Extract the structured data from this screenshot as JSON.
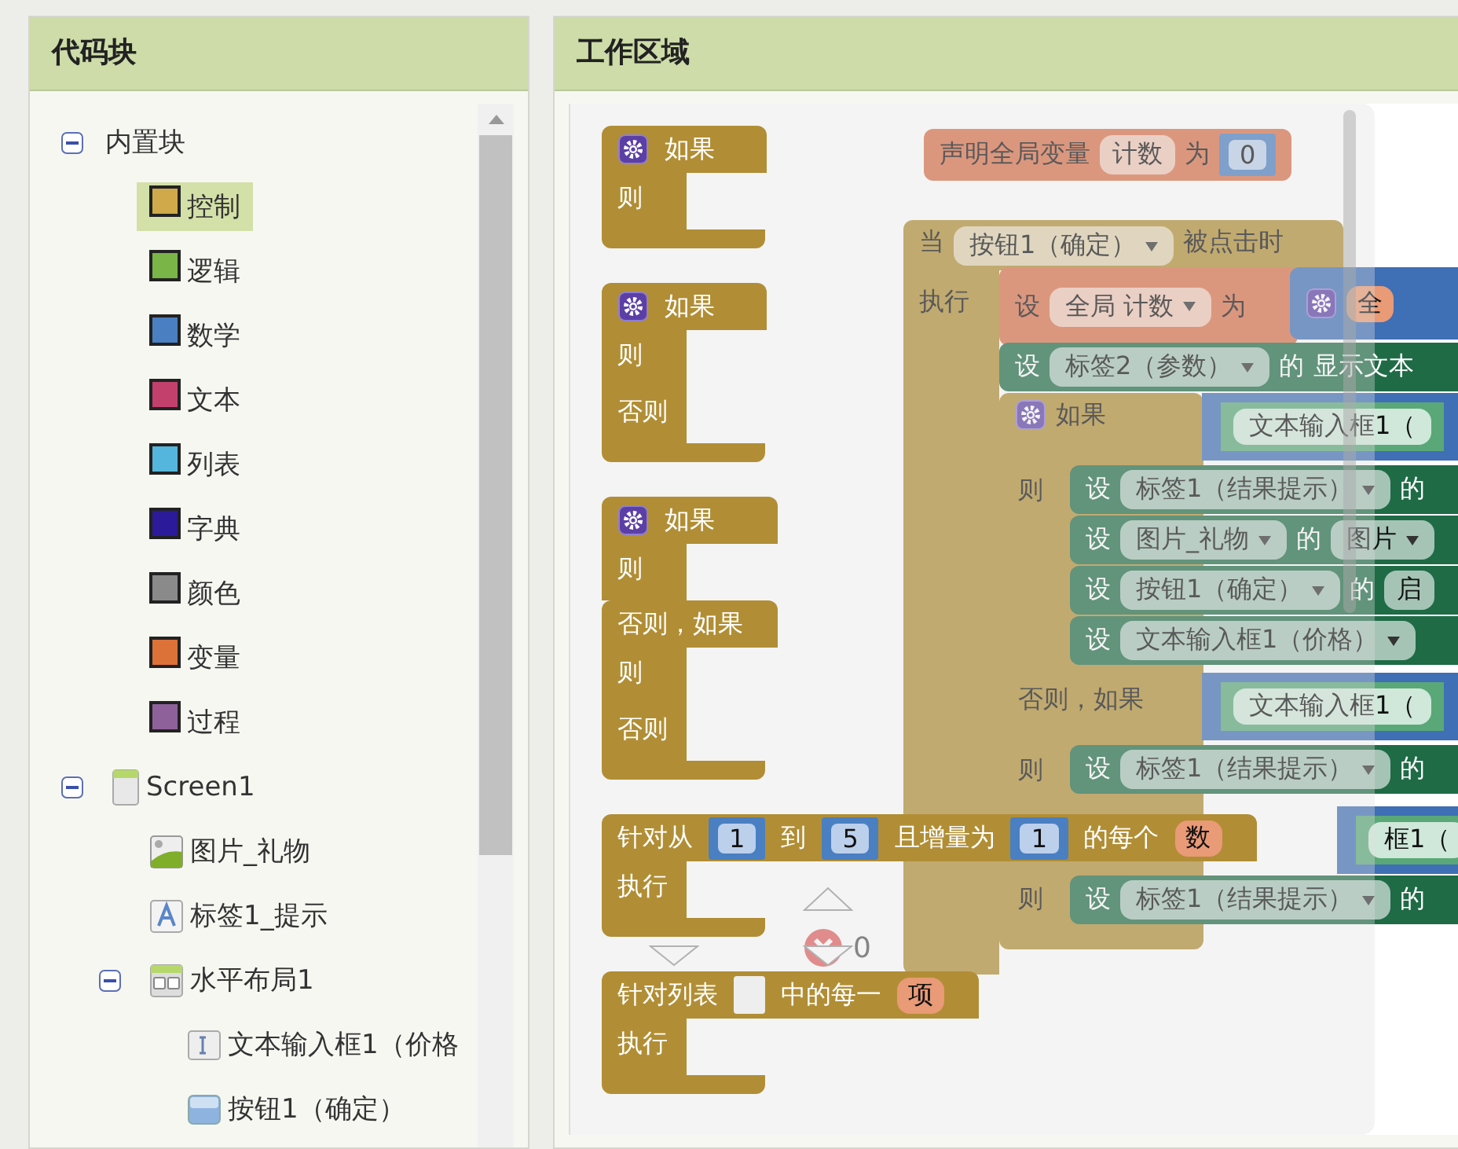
{
  "palette": {
    "title": "代码块",
    "tree": [
      {
        "label": "内置块",
        "kind": "group",
        "expanded": true,
        "children": [
          {
            "label": "控制",
            "kind": "category",
            "color": "#cfa94a",
            "selected": true
          },
          {
            "label": "逻辑",
            "kind": "category",
            "color": "#7ab547",
            "selected": false
          },
          {
            "label": "数学",
            "kind": "category",
            "color": "#4a7fc1",
            "selected": false
          },
          {
            "label": "文本",
            "kind": "category",
            "color": "#c3406d",
            "selected": false
          },
          {
            "label": "列表",
            "kind": "category",
            "color": "#54b6dc",
            "selected": false
          },
          {
            "label": "字典",
            "kind": "category",
            "color": "#2b1a99",
            "selected": false
          },
          {
            "label": "颜色",
            "kind": "category",
            "color": "#8a8a8a",
            "selected": false
          },
          {
            "label": "变量",
            "kind": "category",
            "color": "#dd7238",
            "selected": false
          },
          {
            "label": "过程",
            "kind": "category",
            "color": "#8f619b",
            "selected": false
          }
        ]
      },
      {
        "label": "Screen1",
        "kind": "screen",
        "expanded": true,
        "selected": false,
        "children": [
          {
            "label": "图片_礼物",
            "kind": "image",
            "selected": false
          },
          {
            "label": "标签1_提示",
            "kind": "label",
            "selected": false
          },
          {
            "label": "水平布局1",
            "kind": "layout",
            "expanded": true,
            "selected": false,
            "children": [
              {
                "label": "文本输入框1（价格",
                "kind": "textbox",
                "selected": false
              },
              {
                "label": "按钮1（确定）",
                "kind": "button",
                "selected": false
              }
            ]
          }
        ]
      }
    ]
  },
  "workspace": {
    "title": "工作区域",
    "trash_count": "0",
    "rows": [
      {
        "kind": "global",
        "parts": [
          {
            "kind": "text",
            "text": "声明全局变量"
          },
          {
            "kind": "field",
            "text": "计数"
          },
          {
            "kind": "text",
            "text": "为"
          },
          {
            "kind": "number",
            "text": "0"
          }
        ]
      },
      {
        "kind": "event",
        "parts": [
          {
            "kind": "text",
            "text": "当"
          },
          {
            "kind": "dropdown",
            "text": "按钮1（确定）"
          },
          {
            "kind": "text",
            "text": "被点击时"
          }
        ]
      },
      {
        "kind": "event-body",
        "parts": [
          {
            "kind": "text",
            "text": "执行"
          }
        ]
      },
      {
        "kind": "var-setter",
        "parts": [
          {
            "kind": "text",
            "text": "设"
          },
          {
            "kind": "dropdown",
            "text": "全局 计数"
          },
          {
            "kind": "text",
            "text": "为"
          }
        ]
      },
      {
        "kind": "math",
        "parts": [
          {
            "kind": "gear"
          },
          {
            "kind": "var",
            "text": "全"
          }
        ]
      },
      {
        "kind": "setter",
        "parts": [
          {
            "kind": "text",
            "text": "设"
          },
          {
            "kind": "dropdown",
            "text": "标签2（参数）"
          },
          {
            "kind": "text",
            "text": "的"
          },
          {
            "kind": "text",
            "text": "显示文本"
          }
        ]
      },
      {
        "kind": "if",
        "parts": [
          {
            "kind": "gear"
          },
          {
            "kind": "text",
            "text": "如果"
          }
        ]
      },
      {
        "kind": "socket",
        "parts": [
          {
            "kind": "component",
            "text": "文本输入框1（"
          }
        ]
      },
      {
        "kind": "label",
        "parts": [
          {
            "kind": "text",
            "text": "则"
          }
        ]
      },
      {
        "kind": "setter",
        "parts": [
          {
            "kind": "text",
            "text": "设"
          },
          {
            "kind": "dropdown",
            "text": "标签1（结果提示）"
          },
          {
            "kind": "text",
            "text": "的"
          }
        ]
      },
      {
        "kind": "setter",
        "parts": [
          {
            "kind": "text",
            "text": "设"
          },
          {
            "kind": "dropdown",
            "text": "图片_礼物"
          },
          {
            "kind": "text",
            "text": "的"
          },
          {
            "kind": "dropdown",
            "text": "图片"
          }
        ]
      },
      {
        "kind": "setter",
        "parts": [
          {
            "kind": "text",
            "text": "设"
          },
          {
            "kind": "dropdown",
            "text": "按钮1（确定）"
          },
          {
            "kind": "text",
            "text": "的"
          },
          {
            "kind": "field",
            "text": "启"
          }
        ]
      },
      {
        "kind": "setter",
        "parts": [
          {
            "kind": "text",
            "text": "设"
          },
          {
            "kind": "dropdown",
            "text": "文本输入框1（价格）"
          }
        ]
      },
      {
        "kind": "label",
        "parts": [
          {
            "kind": "text",
            "text": "否则，如果"
          }
        ]
      },
      {
        "kind": "socket",
        "parts": [
          {
            "kind": "component",
            "text": "文本输入框1（"
          }
        ]
      },
      {
        "kind": "label",
        "parts": [
          {
            "kind": "text",
            "text": "则"
          }
        ]
      },
      {
        "kind": "setter",
        "parts": [
          {
            "kind": "text",
            "text": "设"
          },
          {
            "kind": "dropdown",
            "text": "标签1（结果提示）"
          },
          {
            "kind": "text",
            "text": "的"
          }
        ]
      },
      {
        "kind": "socket",
        "parts": [
          {
            "kind": "component",
            "text": "框1（"
          }
        ]
      },
      {
        "kind": "label",
        "parts": [
          {
            "kind": "text",
            "text": "则"
          }
        ]
      },
      {
        "kind": "setter",
        "parts": [
          {
            "kind": "text",
            "text": "设"
          },
          {
            "kind": "dropdown",
            "text": "标签1（结果提示）"
          },
          {
            "kind": "text",
            "text": "的"
          }
        ]
      }
    ]
  },
  "flyout": {
    "blocks": [
      {
        "rows": [
          {
            "kind": "head",
            "parts": [
              {
                "kind": "gear"
              },
              {
                "kind": "text",
                "text": "如果"
              }
            ]
          },
          {
            "kind": "mouth",
            "text": "则"
          }
        ]
      },
      {
        "rows": [
          {
            "kind": "head",
            "parts": [
              {
                "kind": "gear"
              },
              {
                "kind": "text",
                "text": "如果"
              }
            ]
          },
          {
            "kind": "mouth",
            "text": "则"
          },
          {
            "kind": "mouth",
            "text": "否则"
          }
        ]
      },
      {
        "rows": [
          {
            "kind": "head",
            "parts": [
              {
                "kind": "gear"
              },
              {
                "kind": "text",
                "text": "如果"
              }
            ]
          },
          {
            "kind": "mouth",
            "text": "则"
          },
          {
            "kind": "head",
            "parts": [
              {
                "kind": "text",
                "text": "否则，如果"
              }
            ]
          },
          {
            "kind": "mouth",
            "text": "则"
          },
          {
            "kind": "mouth",
            "text": "否则"
          }
        ]
      },
      {
        "rows": [
          {
            "kind": "head",
            "parts": [
              {
                "kind": "text",
                "text": "针对从"
              },
              {
                "kind": "number",
                "text": "1"
              },
              {
                "kind": "text",
                "text": "到"
              },
              {
                "kind": "number",
                "text": "5"
              },
              {
                "kind": "text",
                "text": "且增量为"
              },
              {
                "kind": "number",
                "text": "1"
              },
              {
                "kind": "text",
                "text": "的每个"
              },
              {
                "kind": "var",
                "text": "数"
              }
            ]
          },
          {
            "kind": "mouth",
            "text": "执行"
          }
        ]
      },
      {
        "rows": [
          {
            "kind": "head",
            "parts": [
              {
                "kind": "text",
                "text": "针对列表"
              },
              {
                "kind": "empty"
              },
              {
                "kind": "text",
                "text": "中的每一"
              },
              {
                "kind": "var",
                "text": "项"
              }
            ]
          },
          {
            "kind": "mouth",
            "text": "执行"
          }
        ]
      }
    ]
  }
}
